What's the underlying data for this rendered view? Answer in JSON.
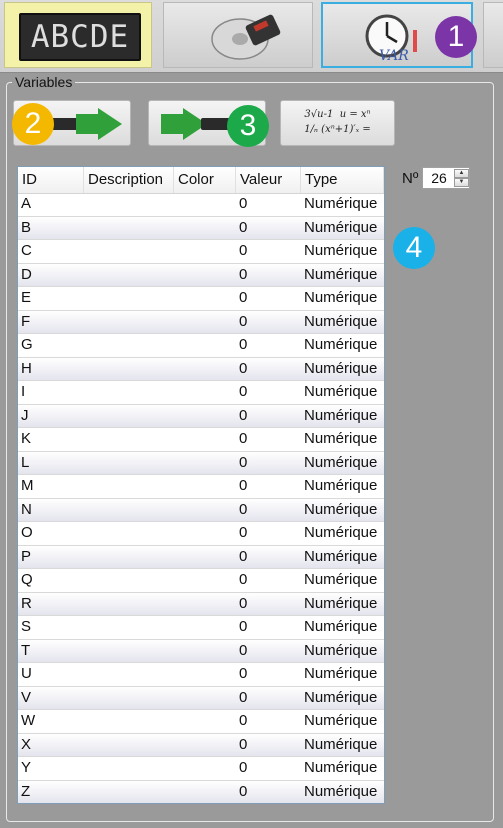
{
  "toolbar": {
    "led_text": "ABCDE",
    "badges": {
      "one": "1",
      "two": "2",
      "three": "3",
      "four": "4"
    }
  },
  "panel": {
    "legend": "Variables",
    "formula_text": "3√u-1  u = xⁿ\n1/ₙ (xⁿ+1)′ₓ ="
  },
  "counter": {
    "label": "Nº",
    "value": "26"
  },
  "table": {
    "columns": {
      "id": "ID",
      "description": "Description",
      "color": "Color",
      "value": "Valeur",
      "type": "Type"
    },
    "rows": [
      {
        "id": "A",
        "description": "",
        "color": "",
        "value": "0",
        "type": "Numérique"
      },
      {
        "id": "B",
        "description": "",
        "color": "",
        "value": "0",
        "type": "Numérique"
      },
      {
        "id": "C",
        "description": "",
        "color": "",
        "value": "0",
        "type": "Numérique"
      },
      {
        "id": "D",
        "description": "",
        "color": "",
        "value": "0",
        "type": "Numérique"
      },
      {
        "id": "E",
        "description": "",
        "color": "",
        "value": "0",
        "type": "Numérique"
      },
      {
        "id": "F",
        "description": "",
        "color": "",
        "value": "0",
        "type": "Numérique"
      },
      {
        "id": "G",
        "description": "",
        "color": "",
        "value": "0",
        "type": "Numérique"
      },
      {
        "id": "H",
        "description": "",
        "color": "",
        "value": "0",
        "type": "Numérique"
      },
      {
        "id": "I",
        "description": "",
        "color": "",
        "value": "0",
        "type": "Numérique"
      },
      {
        "id": "J",
        "description": "",
        "color": "",
        "value": "0",
        "type": "Numérique"
      },
      {
        "id": "K",
        "description": "",
        "color": "",
        "value": "0",
        "type": "Numérique"
      },
      {
        "id": "L",
        "description": "",
        "color": "",
        "value": "0",
        "type": "Numérique"
      },
      {
        "id": "M",
        "description": "",
        "color": "",
        "value": "0",
        "type": "Numérique"
      },
      {
        "id": "N",
        "description": "",
        "color": "",
        "value": "0",
        "type": "Numérique"
      },
      {
        "id": "O",
        "description": "",
        "color": "",
        "value": "0",
        "type": "Numérique"
      },
      {
        "id": "P",
        "description": "",
        "color": "",
        "value": "0",
        "type": "Numérique"
      },
      {
        "id": "Q",
        "description": "",
        "color": "",
        "value": "0",
        "type": "Numérique"
      },
      {
        "id": "R",
        "description": "",
        "color": "",
        "value": "0",
        "type": "Numérique"
      },
      {
        "id": "S",
        "description": "",
        "color": "",
        "value": "0",
        "type": "Numérique"
      },
      {
        "id": "T",
        "description": "",
        "color": "",
        "value": "0",
        "type": "Numérique"
      },
      {
        "id": "U",
        "description": "",
        "color": "",
        "value": "0",
        "type": "Numérique"
      },
      {
        "id": "V",
        "description": "",
        "color": "",
        "value": "0",
        "type": "Numérique"
      },
      {
        "id": "W",
        "description": "",
        "color": "",
        "value": "0",
        "type": "Numérique"
      },
      {
        "id": "X",
        "description": "",
        "color": "",
        "value": "0",
        "type": "Numérique"
      },
      {
        "id": "Y",
        "description": "",
        "color": "",
        "value": "0",
        "type": "Numérique"
      },
      {
        "id": "Z",
        "description": "",
        "color": "",
        "value": "0",
        "type": "Numérique"
      }
    ]
  },
  "icons": {
    "led": "led-display-icon",
    "disk": "disk-icon",
    "variables": "clock-variables-icon",
    "export": "arrow-right-icon",
    "import": "arrow-right-icon",
    "formula": "formula-icon"
  },
  "colors": {
    "badge_1": "#7b35a6",
    "badge_2": "#f5b800",
    "badge_3": "#1ca94a",
    "badge_4": "#1ab0e8",
    "arrow_green": "#2fa03a",
    "selected_border": "#3aaee0"
  }
}
